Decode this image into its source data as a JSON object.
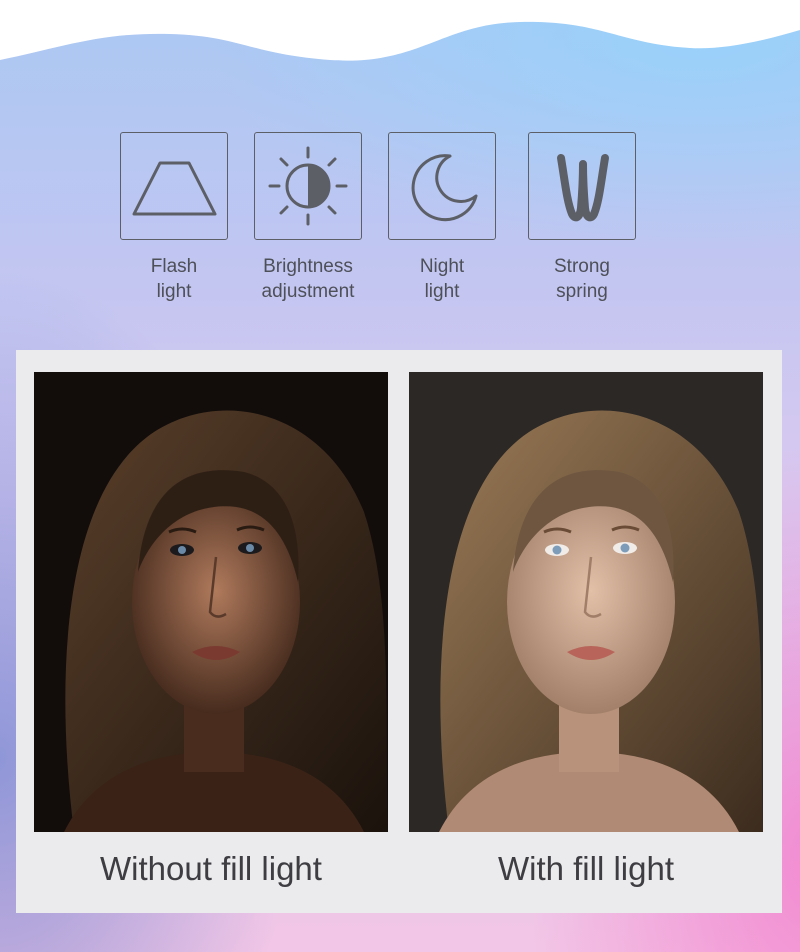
{
  "features": [
    {
      "icon": "flash-light-icon",
      "label": "Flash\nlight"
    },
    {
      "icon": "brightness-icon",
      "label": "Brightness\nadjustment"
    },
    {
      "icon": "moon-icon",
      "label": "Night\nlight"
    },
    {
      "icon": "spring-icon",
      "label": "Strong\nspring"
    }
  ],
  "comparison": {
    "left_caption": "Without fill light",
    "right_caption": "With fill light"
  },
  "colors": {
    "icon_stroke": "#5d5f67",
    "panel_background": "#ebebed",
    "caption_text": "#3d3d42"
  }
}
